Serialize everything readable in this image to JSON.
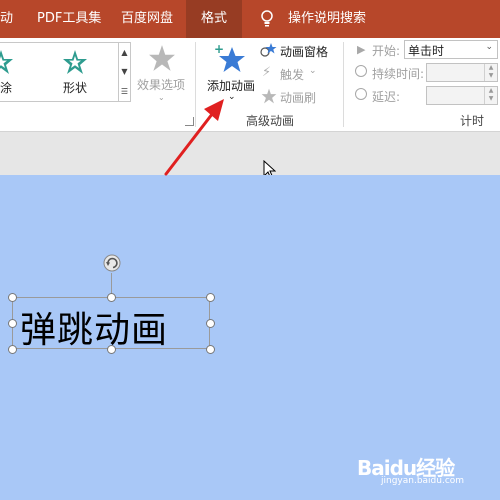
{
  "tabs": [
    {
      "label": "动"
    },
    {
      "label": "PDF工具集"
    },
    {
      "label": "百度网盘"
    },
    {
      "label": "格式"
    },
    {
      "label": "操作说明搜索"
    }
  ],
  "gallery": {
    "item1_label": "涂",
    "item2_label": "形状"
  },
  "effect_options": {
    "label": "效果选项"
  },
  "advanced_animation": {
    "add_animation": "添加动画",
    "animation_pane": "动画窗格",
    "trigger": "触发",
    "animation_painter": "动画刷",
    "group_title": "高级动画"
  },
  "timing": {
    "start_label": "开始:",
    "start_value": "单击时",
    "duration_label": "持续时间:",
    "delay_label": "延迟:",
    "group_title": "计时"
  },
  "slide": {
    "text": "弹跳动画"
  },
  "watermark": {
    "main": "Baidu经验",
    "sub": "jingyan.baidu.com"
  },
  "colors": {
    "ribbon_accent": "#b7472a",
    "active_tab": "#973c23",
    "slide_background": "#a9c8f7",
    "star_blue": "#3a7bd5",
    "star_teal": "#2e9c8f",
    "arrow": "#e02020"
  }
}
